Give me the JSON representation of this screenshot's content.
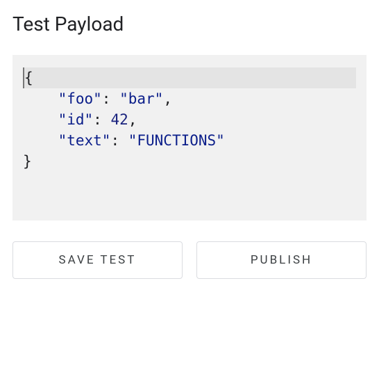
{
  "section": {
    "title": "Test Payload"
  },
  "payload": {
    "line1": "{",
    "line2_key": "\"foo\"",
    "line2_colon": ": ",
    "line2_val": "\"bar\"",
    "line2_comma": ",",
    "line3_key": "\"id\"",
    "line3_colon": ": ",
    "line3_val": "42",
    "line3_comma": ",",
    "line4_key": "\"text\"",
    "line4_colon": ": ",
    "line4_val": "\"FUNCTIONS\"",
    "line5": "}",
    "indent": "    "
  },
  "buttons": {
    "save_test": "SAVE TEST",
    "publish": "PUBLISH"
  }
}
